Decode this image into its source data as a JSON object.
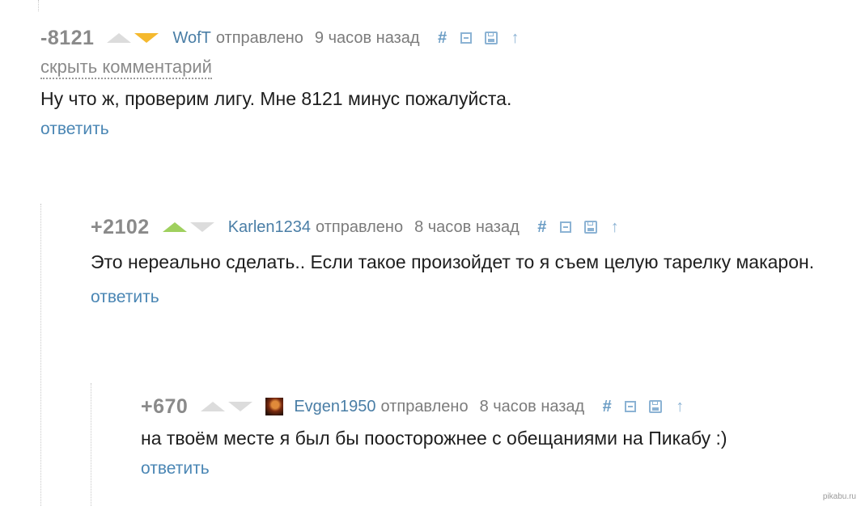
{
  "comments": [
    {
      "rating": "-8121",
      "vote": "down",
      "author": "WofT",
      "sent_label": "отправлено",
      "time": "9 часов назад",
      "hide_label": "скрыть комментарий",
      "text": "Ну что ж, проверим лигу. Мне 8121 минус пожалуйста.",
      "reply_label": "ответить"
    },
    {
      "rating": "+2102",
      "vote": "up",
      "author": "Karlen1234",
      "sent_label": "отправлено",
      "time": "8 часов назад",
      "text": "Это нереально сделать.. Если такое произойдет то я съем целую тарелку макарон.",
      "reply_label": "ответить"
    },
    {
      "rating": "+670",
      "vote": "none",
      "author": "Evgen1950",
      "sent_label": "отправлено",
      "time": "8 часов назад",
      "text": "на твоём месте я был бы поосторожнее с обещаниями на Пикабу :)",
      "reply_label": "ответить"
    }
  ],
  "tools": {
    "hash_glyph": "#",
    "up_glyph": "↑"
  },
  "icons": [
    "upvote-icon",
    "downvote-icon",
    "hash-icon",
    "collapse-icon",
    "save-icon",
    "parent-arrow-icon"
  ],
  "colors": {
    "author_link": "#4a7ea6",
    "upvote_active": "#9fd05e",
    "downvote_active": "#f5b92e",
    "reply_link": "#4a86b4"
  },
  "watermark": "pikabu.ru"
}
